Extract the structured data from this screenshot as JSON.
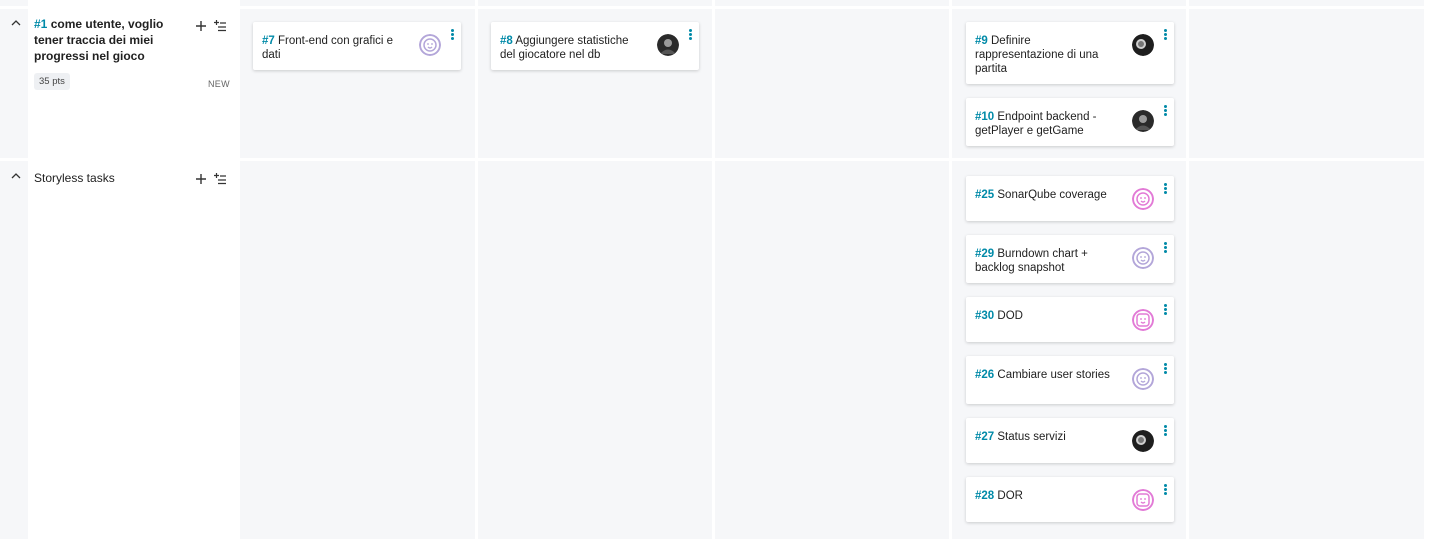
{
  "stories": [
    {
      "ref": "#1",
      "title": "come utente, voglio tener traccia dei miei progressi nel gioco",
      "points": "35 pts",
      "status": "NEW"
    }
  ],
  "storyless": {
    "title": "Storyless tasks"
  },
  "tasks": {
    "t7": {
      "ref": "#7",
      "title": "Front-end con grafici e dati",
      "avatar": "lavender-face-icon"
    },
    "t8": {
      "ref": "#8",
      "title": "Aggiungere statistiche del giocatore nel db",
      "avatar": "photo-avatar"
    },
    "t9": {
      "ref": "#9",
      "title": "Definire rappresentazione di una partita",
      "avatar": "photo-avatar"
    },
    "t10": {
      "ref": "#10",
      "title": "Endpoint backend - getPlayer e getGame",
      "avatar": "photo-avatar"
    },
    "t25": {
      "ref": "#25",
      "title": "SonarQube coverage",
      "avatar": "pink-face-icon"
    },
    "t29": {
      "ref": "#29",
      "title": "Burndown chart + backlog snapshot",
      "avatar": "lavender-face-icon"
    },
    "t30": {
      "ref": "#30",
      "title": "DOD",
      "avatar": "pink-face-icon"
    },
    "t26": {
      "ref": "#26",
      "title": "Cambiare user stories",
      "avatar": "lavender-face-icon"
    },
    "t27": {
      "ref": "#27",
      "title": "Status servizi",
      "avatar": "photo-avatar"
    },
    "t28": {
      "ref": "#28",
      "title": "DOR",
      "avatar": "pink-face-icon"
    }
  },
  "colors": {
    "accent": "#008aa8",
    "column_bg": "#f6f7f9",
    "avatar_lavender": "#b3a6d9",
    "avatar_pink": "#e27ad6"
  }
}
